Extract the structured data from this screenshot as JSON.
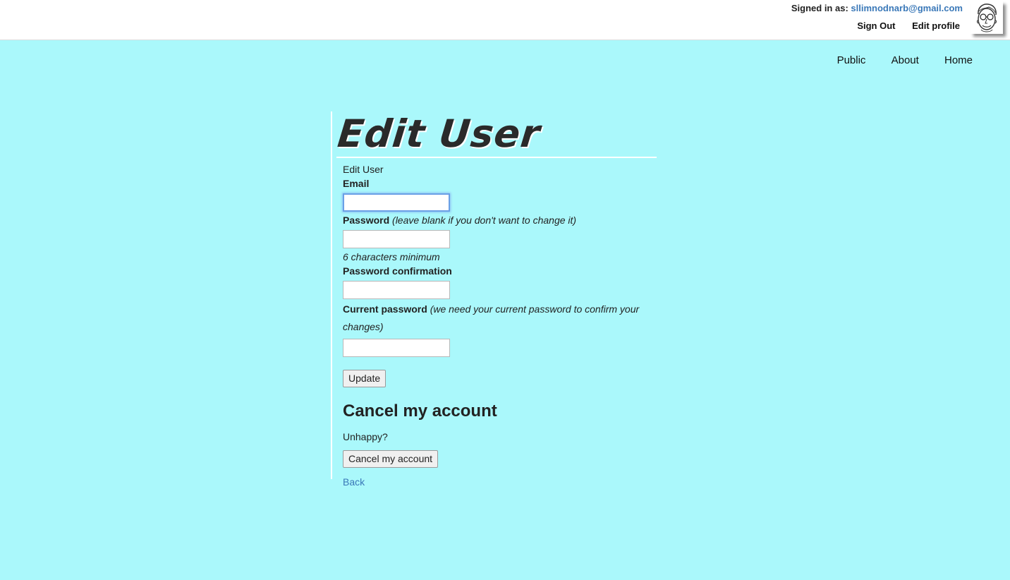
{
  "header": {
    "signed_in_label": "Signed in as:",
    "email": "sllimnodnarb@gmail.com",
    "sign_out": "Sign Out",
    "edit_profile": "Edit profile"
  },
  "nav": {
    "public": "Public",
    "about": "About",
    "home": "Home"
  },
  "page": {
    "title": "Edit User",
    "subheading": "Edit User"
  },
  "form": {
    "email_label": "Email",
    "email_value": "",
    "password_label": "Password",
    "password_hint": "(leave blank if you don't want to change it)",
    "password_value": "",
    "password_note": "6 characters minimum",
    "password_confirmation_label": "Password confirmation",
    "password_confirmation_value": "",
    "current_password_label": "Current password",
    "current_password_hint": "(we need your current password to confirm your changes)",
    "current_password_value": "",
    "update_button": "Update"
  },
  "cancel": {
    "heading": "Cancel my account",
    "text": "Unhappy?",
    "button": "Cancel my account"
  },
  "back_link": "Back"
}
